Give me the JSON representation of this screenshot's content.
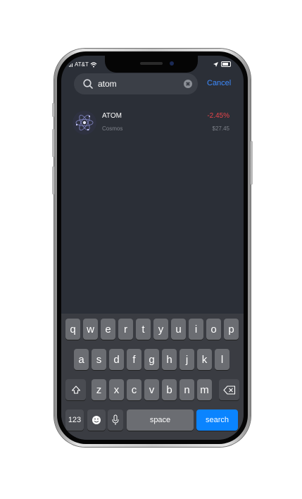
{
  "status_bar": {
    "carrier": "AT&T",
    "icons": [
      "signal-icon",
      "wifi-icon",
      "location-icon",
      "battery-icon"
    ]
  },
  "search": {
    "value": "atom",
    "cancel_label": "Cancel"
  },
  "results": [
    {
      "symbol": "ATOM",
      "name": "Cosmos",
      "change": "-2.45%",
      "price": "$27.45"
    }
  ],
  "keyboard": {
    "row1": [
      "q",
      "w",
      "e",
      "r",
      "t",
      "y",
      "u",
      "i",
      "o",
      "p"
    ],
    "row2": [
      "a",
      "s",
      "d",
      "f",
      "g",
      "h",
      "j",
      "k",
      "l"
    ],
    "row3": [
      "z",
      "x",
      "c",
      "v",
      "b",
      "n",
      "m"
    ],
    "numbers_label": "123",
    "space_label": "space",
    "search_label": "search"
  },
  "colors": {
    "background": "#2b2f37",
    "accent": "#3d8bff",
    "negative": "#e8454b",
    "search_key": "#0a84ff"
  }
}
